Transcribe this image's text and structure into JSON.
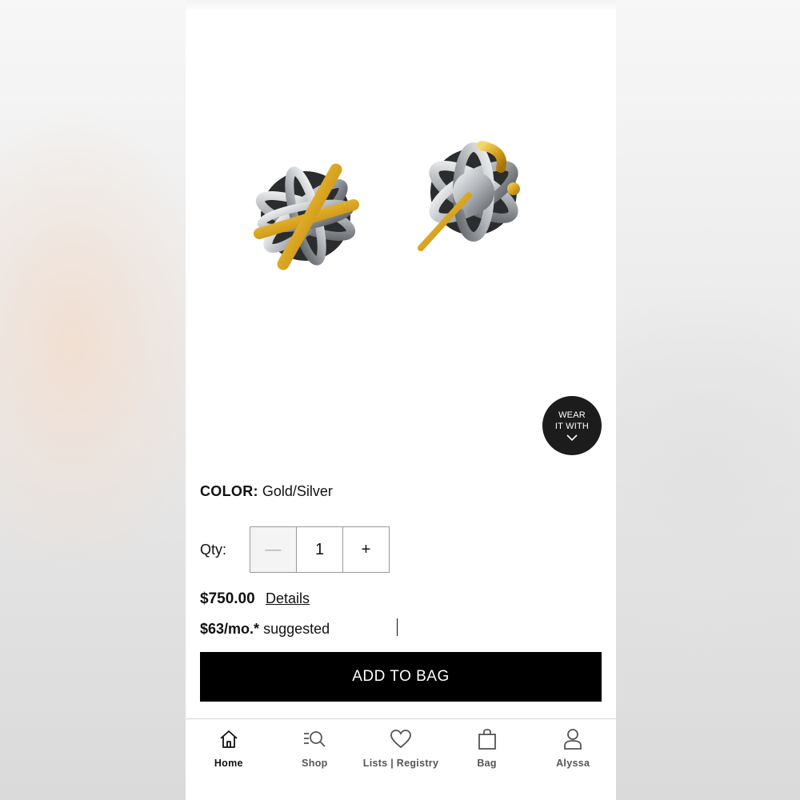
{
  "product": {
    "image_alt": "",
    "color_label": "COLOR:",
    "color_value": "Gold/Silver",
    "qty_label": "Qty:",
    "qty_value": "1",
    "decrement_symbol": "—",
    "increment_symbol": "+",
    "price": "$750.00",
    "details_link": "Details",
    "monthly_amount": "$63/mo.*",
    "monthly_text": "suggested",
    "add_to_bag_label": "ADD TO BAG"
  },
  "wear_it_with": {
    "line1": "WEAR",
    "line2": "IT WITH",
    "icon": "chevron-down-icon"
  },
  "bottom_nav": {
    "items": [
      {
        "label": "Home",
        "icon": "home-icon",
        "active": true
      },
      {
        "label": "Shop",
        "icon": "search-list-icon",
        "active": false
      },
      {
        "label": "Lists | Registry",
        "icon": "heart-icon",
        "active": false
      },
      {
        "label": "Bag",
        "icon": "bag-icon",
        "active": false
      },
      {
        "label": "Alyssa",
        "icon": "user-icon",
        "active": false
      }
    ]
  },
  "colors": {
    "gold": "#d9a521",
    "silver": "#b9bcc0",
    "button_bg": "#000000",
    "wear_bg": "#1c1c1c"
  }
}
